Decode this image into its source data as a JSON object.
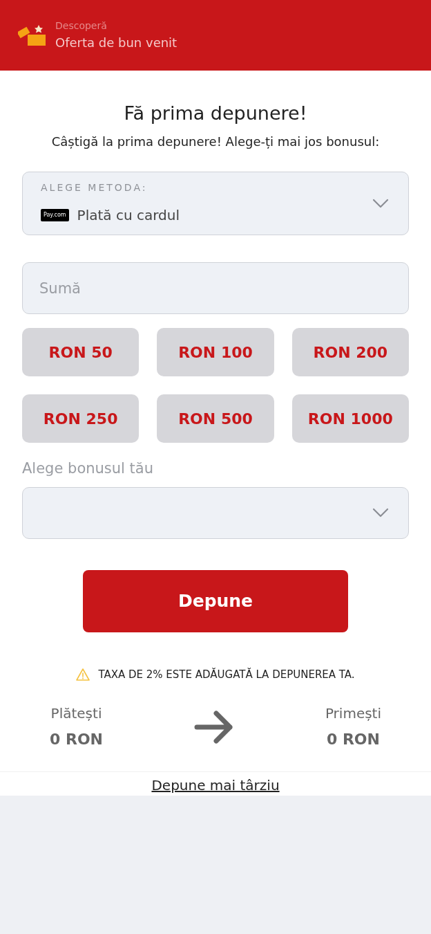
{
  "header": {
    "eyebrow": "Descoperă",
    "title": "Oferta de bun venit"
  },
  "heading": "Fă prima depunere!",
  "subheading": "Câștigă la prima depunere! Alege-ți mai jos bonusul:",
  "method": {
    "label": "ALEGE METODA:",
    "logo": "Pay.com",
    "value": "Plată cu cardul"
  },
  "amount": {
    "placeholder": "Sumă"
  },
  "presets": [
    "RON 50",
    "RON 100",
    "RON 200",
    "RON 250",
    "RON 500",
    "RON 1000"
  ],
  "bonus": {
    "label": "Alege bonusul tău"
  },
  "submit": "Depune",
  "notice": "TAXA DE 2% ESTE ADĂUGATĂ LA DEPUNEREA TA.",
  "summary": {
    "pay_label": "Plătești",
    "pay_value": "0 RON",
    "get_label": "Primești",
    "get_value": "0 RON"
  },
  "later_link": "Depune mai târziu"
}
